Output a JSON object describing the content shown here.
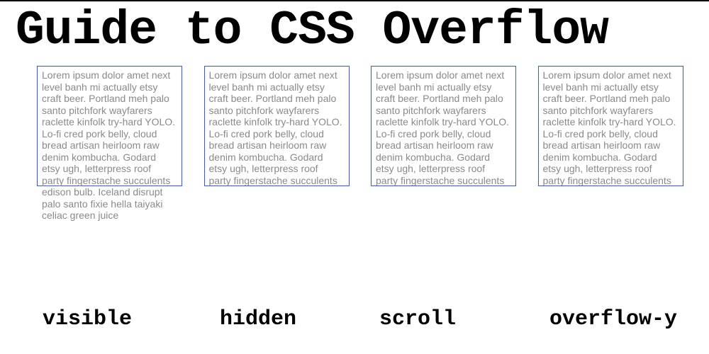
{
  "title": "Guide to CSS Overflow",
  "examples": [
    {
      "label": "visible",
      "overflow_class": "box-visible",
      "text": "Lorem ipsum dolor amet next level banh mi actually etsy craft beer. Portland meh palo santo pitchfork wayfarers raclette kinfolk try-hard YOLO. Lo-fi cred pork belly, cloud bread artisan heirloom raw denim kombucha. Godard etsy ugh, letterpress roof party fingerstache succulents edison bulb. Iceland disrupt palo santo fixie hella taiyaki celiac green juice"
    },
    {
      "label": "hidden",
      "overflow_class": "box-hidden",
      "text": "Lorem ipsum dolor amet next level banh mi actually etsy craft beer. Portland meh palo santo pitchfork wayfarers raclette kinfolk try-hard YOLO. Lo-fi cred pork belly, cloud bread artisan heirloom raw denim kombucha. Godard etsy ugh, letterpress roof party fingerstache succulents edison bulb. Iceland disrupt palo santo fixie hella taiyaki celiac green juice"
    },
    {
      "label": "scroll",
      "overflow_class": "box-scroll",
      "text": "Lorem ipsum dolor amet next level banh mi actually etsy craft beer. Portland meh palo santo pitchfork wayfarers raclette kinfolk try-hard YOLO. Lo-fi cred pork belly, cloud bread artisan heirloom raw denim kombucha. Godard etsy ugh, letterpress roof party fingerstache succulents edison bulb. Iceland disrupt palo santo fixie hella taiyaki celiac green juice"
    },
    {
      "label": "overflow-y",
      "overflow_class": "box-scrolly",
      "text": "Lorem ipsum dolor amet next level banh mi actually etsy craft beer. Portland meh palo santo pitchfork wayfarers raclette kinfolk try-hard YOLO. Lo-fi cred pork belly, cloud bread artisan heirloom raw denim kombucha. Godard etsy ugh, letterpress roof party fingerstache succulents edison bulb. Iceland disrupt palo santo fixie hella taiyaki celiac green juice"
    }
  ]
}
